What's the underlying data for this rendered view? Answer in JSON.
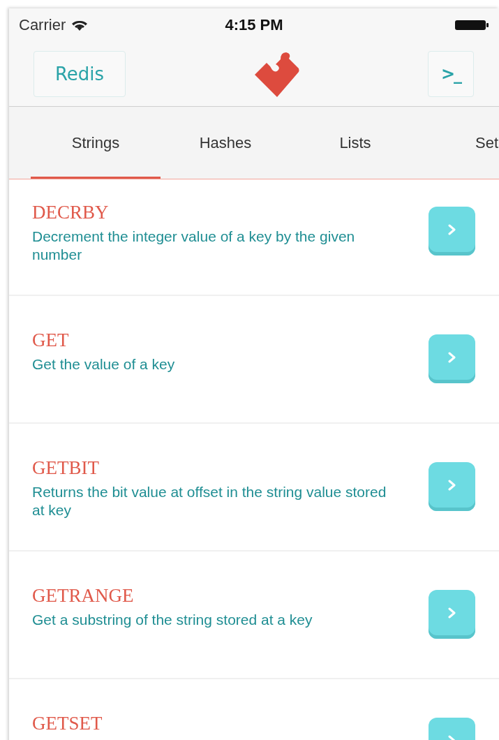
{
  "status_bar": {
    "carrier": "Carrier",
    "time": "4:15 PM"
  },
  "nav": {
    "left_button": "Redis",
    "right_button": ">_"
  },
  "tabs": [
    {
      "label": "Strings",
      "selected": true
    },
    {
      "label": "Hashes",
      "selected": false
    },
    {
      "label": "Lists",
      "selected": false
    },
    {
      "label": "Set",
      "selected": false
    }
  ],
  "commands": [
    {
      "name": "DECRBY",
      "description": "Decrement the integer value of a key by the given number"
    },
    {
      "name": "GET",
      "description": "Get the value of a key"
    },
    {
      "name": "GETBIT",
      "description": "Returns the bit value at offset in the string value stored at key"
    },
    {
      "name": "GETRANGE",
      "description": "Get a substring of the string stored at a key"
    },
    {
      "name": "GETSET"
    }
  ]
}
